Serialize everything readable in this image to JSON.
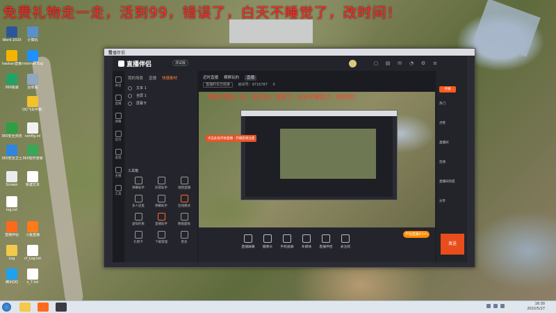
{
  "overlay": {
    "banner": "免费礼物走一走，活到99，错误了，白天不睡觉了，改时间！"
  },
  "desktop": {
    "icons": [
      {
        "label": "Word 2020",
        "color": "#2b579a"
      },
      {
        "label": "计算机",
        "color": "#5b8fc7"
      },
      {
        "label": "haokan直播",
        "color": "#f4b400"
      },
      {
        "label": "Internet Explorer",
        "color": "#1e90ff"
      },
      {
        "label": "360极速",
        "color": "#21a365"
      },
      {
        "label": "回收站",
        "color": "#8fa7bf"
      },
      {
        "label": "QQ飞车伴奏工具",
        "color": "#f2c12e"
      },
      {
        "label": "360安全浏览器",
        "color": "#2f9e44"
      },
      {
        "label": "config.ini",
        "color": "#f1f1f1"
      },
      {
        "label": "360安全卫士",
        "color": "#2e86de"
      },
      {
        "label": "360软件管家",
        "color": "#3aa657"
      },
      {
        "label": "Screen",
        "color": "#e9ecef"
      },
      {
        "label": "新建文本",
        "color": "#ffffff"
      },
      {
        "label": "log.txt",
        "color": "#ffffff"
      },
      {
        "label": "直播伴侣",
        "color": "#ff6a1a"
      },
      {
        "label": "斗鱼直播",
        "color": "#ff7a18"
      },
      {
        "label": "Log",
        "color": "#f2c94c"
      },
      {
        "label": "cf_Log.txt",
        "color": "#ffffff"
      },
      {
        "label": "腾讯QQ",
        "color": "#1da1f2"
      },
      {
        "label": "s_7.txt",
        "color": "#ffffff"
      }
    ]
  },
  "taskbar": {
    "time": "16:30",
    "date": "2022/5/27"
  },
  "window": {
    "title": "直播伴侣",
    "minimize": "—",
    "maximize": "□",
    "close": "✕"
  },
  "app": {
    "logo_text": "直播伴侣",
    "version": "测试版",
    "rail": [
      "关注",
      "直播",
      "弹幕",
      "首页",
      "发现",
      "主播",
      "工具"
    ],
    "left_tabs": [
      "我的场景",
      "直播",
      "快捷素材"
    ],
    "left_tab_active": 2,
    "scenes": [
      "文本 1",
      "全屏 1",
      "屏幕卡"
    ],
    "tools_title": "工具箱",
    "tools": [
      "弹幕助手",
      "房管助手",
      "视频直播",
      "多人连麦",
      "弹幕助手",
      "连线模式",
      "虚拟形象",
      "直播助手",
      "数据面板",
      "礼物卡",
      "下载管理",
      "更多"
    ],
    "center_tabs": [
      "近时直播",
      "横屏玩的",
      "直播"
    ],
    "meta_chip": "直播时长已结束",
    "meta_id": "房间号：9716787",
    "meta_fans": "0",
    "preview_banner": "免费礼物走一走，活到99，错误了，白天不睡觉了，改时间！",
    "orange_tip": "点击此处开始直播 · 开播后请注意",
    "controls": [
      "直播屏幕",
      "摄像头",
      "手机投屏",
      "多媒体",
      "直播伴侣",
      "关注的"
    ],
    "right_labels": [
      "热门",
      "点赞",
      "直播间",
      "连线",
      "直播间热度",
      "分享"
    ],
    "open_live": "开播",
    "live_button": "开始直播(Ctrl)",
    "send_button": "发送"
  }
}
